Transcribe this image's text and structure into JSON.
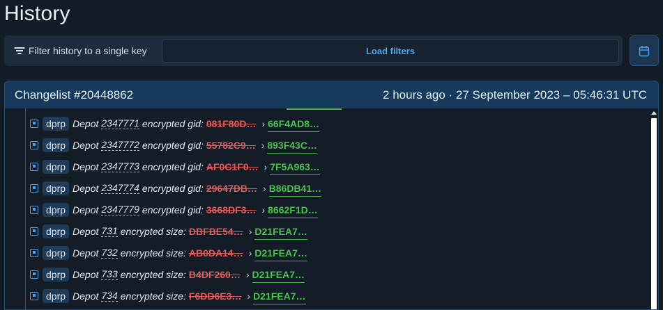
{
  "page": {
    "title": "History"
  },
  "filter": {
    "label": "Filter history to a single key",
    "load_button": "Load filters"
  },
  "icons": {
    "filter": "filter-lines-icon",
    "calendar": "calendar-icon",
    "row": "dotted-square-icon"
  },
  "colors": {
    "accent": "#4ea8f0",
    "removed": "#e05b5b",
    "added": "#4cc24f",
    "header_bg": "#163a5c"
  },
  "changelist": {
    "title": "Changelist #20448862",
    "timestamp": "2 hours ago · 27 September 2023 – 05:46:31 UTC",
    "rows": [
      {
        "badge": "dprp",
        "prefix": "Depot",
        "depot": "2347771",
        "field": "encrypted gid:",
        "old": "081F80D…",
        "arrow": "›",
        "new": "66F4AD8…"
      },
      {
        "badge": "dprp",
        "prefix": "Depot",
        "depot": "2347772",
        "field": "encrypted gid:",
        "old": "55782C9…",
        "arrow": "›",
        "new": "893F43C…"
      },
      {
        "badge": "dprp",
        "prefix": "Depot",
        "depot": "2347773",
        "field": "encrypted gid:",
        "old": "AF0C1F0…",
        "arrow": "›",
        "new": "7F5A963…"
      },
      {
        "badge": "dprp",
        "prefix": "Depot",
        "depot": "2347774",
        "field": "encrypted gid:",
        "old": "29647DB…",
        "arrow": "›",
        "new": "B86DB41…"
      },
      {
        "badge": "dprp",
        "prefix": "Depot",
        "depot": "2347779",
        "field": "encrypted gid:",
        "old": "3668DF3…",
        "arrow": "›",
        "new": "8662F1D…"
      },
      {
        "badge": "dprp",
        "prefix": "Depot",
        "depot": "731",
        "field": "encrypted size:",
        "old": "DBFBE54…",
        "arrow": "›",
        "new": "D21FEA7…"
      },
      {
        "badge": "dprp",
        "prefix": "Depot",
        "depot": "732",
        "field": "encrypted size:",
        "old": "AB0DA14…",
        "arrow": "›",
        "new": "D21FEA7…"
      },
      {
        "badge": "dprp",
        "prefix": "Depot",
        "depot": "733",
        "field": "encrypted size:",
        "old": "B4DF260…",
        "arrow": "›",
        "new": "D21FEA7…"
      },
      {
        "badge": "dprp",
        "prefix": "Depot",
        "depot": "734",
        "field": "encrypted size:",
        "old": "F6DD6E3…",
        "arrow": "›",
        "new": "D21FEA7…"
      }
    ]
  }
}
